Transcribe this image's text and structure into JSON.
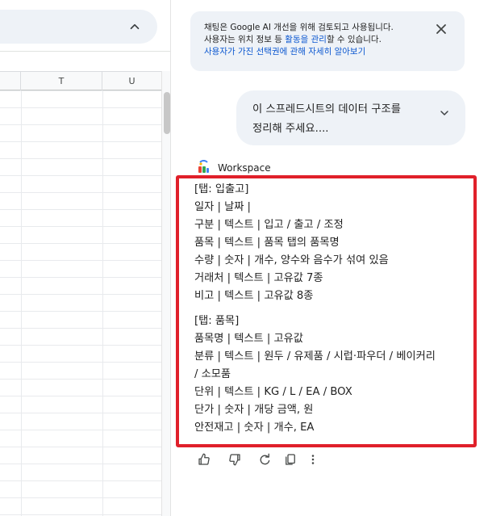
{
  "sheet": {
    "columns": [
      "T",
      "U"
    ]
  },
  "chat": {
    "notice": {
      "line1": "채팅은 Google AI 개선을 위해 검토되고 사용됩니다.",
      "line2_prefix": "사용자는 위치 정보 등 ",
      "line2_link": "활동을 관리",
      "line2_suffix": "할 수 있습니다.",
      "line3_link": "사용자가 가진 선택권에 관해 자세히 알아보기"
    },
    "user_message": {
      "line1": "이 스프레드시트의 데이터 구조를",
      "line2": "정리해 주세요...."
    },
    "assistant_name": "Workspace",
    "response": {
      "block1": [
        "[탭: 입출고]",
        "일자   | 날짜   |",
        "구분   | 텍스트 | 입고 / 출고 / 조정",
        "품목   | 텍스트 | 품목 탭의 품목명",
        "수량   | 숫자   | 개수, 양수와 음수가 섞여 있음",
        "거래처 | 텍스트 | 고유값 7종",
        "비고   | 텍스트 | 고유값 8종"
      ],
      "block2": [
        "[탭: 품목]",
        "품목명   | 텍스트 | 고유값",
        "분류     | 텍스트 | 원두 / 유제품 / 시럽·파우더 / 베이커리",
        "/ 소모품",
        "단위     | 텍스트 | KG / L / EA / BOX",
        "단가     | 숫자   | 개당 금액, 원",
        "안전재고 | 숫자   | 개수, EA"
      ]
    },
    "actions": [
      "thumb-up-icon",
      "thumb-down-icon",
      "refresh-icon",
      "copy-icon",
      "more-vert-icon"
    ]
  },
  "colors": {
    "highlight_border": "#e0202a",
    "link": "#0b57d0",
    "bubble": "#eef2f7"
  }
}
